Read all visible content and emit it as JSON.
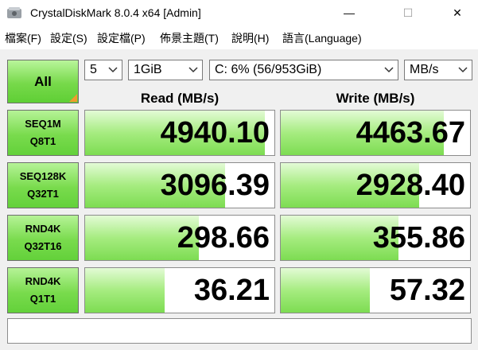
{
  "window": {
    "title": "CrystalDiskMark 8.0.4 x64 [Admin]",
    "minimize_glyph": "—",
    "maximize_glyph": "☐",
    "close_glyph": "✕"
  },
  "menu": [
    "檔案(F)",
    "設定(S)",
    "設定檔(P)",
    "佈景主題(T)",
    "說明(H)",
    "語言(Language)"
  ],
  "toolbar": {
    "all_button": "All",
    "count": "5",
    "size": "1GiB",
    "drive": "C: 6% (56/953GiB)",
    "unit": "MB/s"
  },
  "headers": {
    "read": "Read (MB/s)",
    "write": "Write (MB/s)"
  },
  "tests": [
    {
      "line1": "SEQ1M",
      "line2": "Q8T1",
      "read": "4940.10",
      "write": "4463.67",
      "read_fill": 0.95,
      "write_fill": 0.86
    },
    {
      "line1": "SEQ128K",
      "line2": "Q32T1",
      "read": "3096.39",
      "write": "2928.40",
      "read_fill": 0.74,
      "write_fill": 0.73
    },
    {
      "line1": "RND4K",
      "line2": "Q32T16",
      "read": "298.66",
      "write": "355.86",
      "read_fill": 0.6,
      "write_fill": 0.62
    },
    {
      "line1": "RND4K",
      "line2": "Q1T1",
      "read": "36.21",
      "write": "57.32",
      "read_fill": 0.42,
      "write_fill": 0.47
    }
  ],
  "comment": "",
  "colors": {
    "accent_green": "#79db4d",
    "corner_orange": "#f29a2e"
  }
}
